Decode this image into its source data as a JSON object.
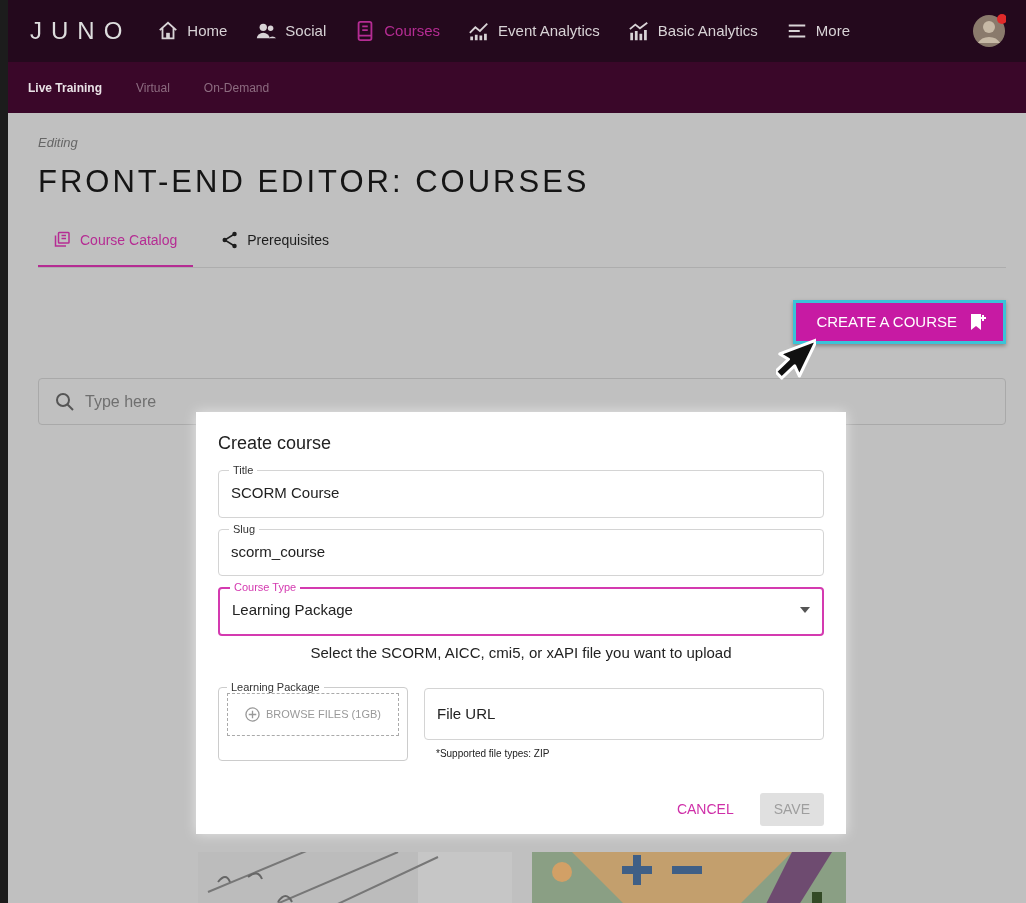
{
  "brand": "JUNO",
  "nav": [
    {
      "label": "Home",
      "selected": false
    },
    {
      "label": "Social",
      "selected": false
    },
    {
      "label": "Courses",
      "selected": true
    },
    {
      "label": "Event Analytics",
      "selected": false
    },
    {
      "label": "Basic Analytics",
      "selected": false
    },
    {
      "label": "More",
      "selected": false
    }
  ],
  "subnav": [
    {
      "label": "Live Training",
      "selected": true
    },
    {
      "label": "Virtual",
      "selected": false
    },
    {
      "label": "On-Demand",
      "selected": false
    }
  ],
  "page": {
    "eyebrow": "Editing",
    "title": "FRONT-END EDITOR: COURSES"
  },
  "tabs": [
    {
      "label": "Course Catalog",
      "selected": true
    },
    {
      "label": "Prerequisites",
      "selected": false
    }
  ],
  "create_button": "CREATE A COURSE",
  "search": {
    "placeholder": "Type here"
  },
  "dialog": {
    "title": "Create course",
    "fields": [
      {
        "label": "Title",
        "value": "SCORM Course",
        "kind": "text",
        "focused": false
      },
      {
        "label": "Slug",
        "value": "scorm_course",
        "kind": "text",
        "focused": false
      },
      {
        "label": "Course Type",
        "value": "Learning Package",
        "kind": "select",
        "focused": true
      }
    ],
    "hint": "Select the SCORM, AICC, cmi5, or xAPI file you want to upload",
    "upload": {
      "label": "Learning Package",
      "button": "BROWSE FILES (1GB)"
    },
    "url": {
      "placeholder": "File URL",
      "helper": "*Supported file types: ZIP"
    },
    "cancel": "CANCEL",
    "save": {
      "label": "SAVE",
      "disabled": true
    }
  }
}
